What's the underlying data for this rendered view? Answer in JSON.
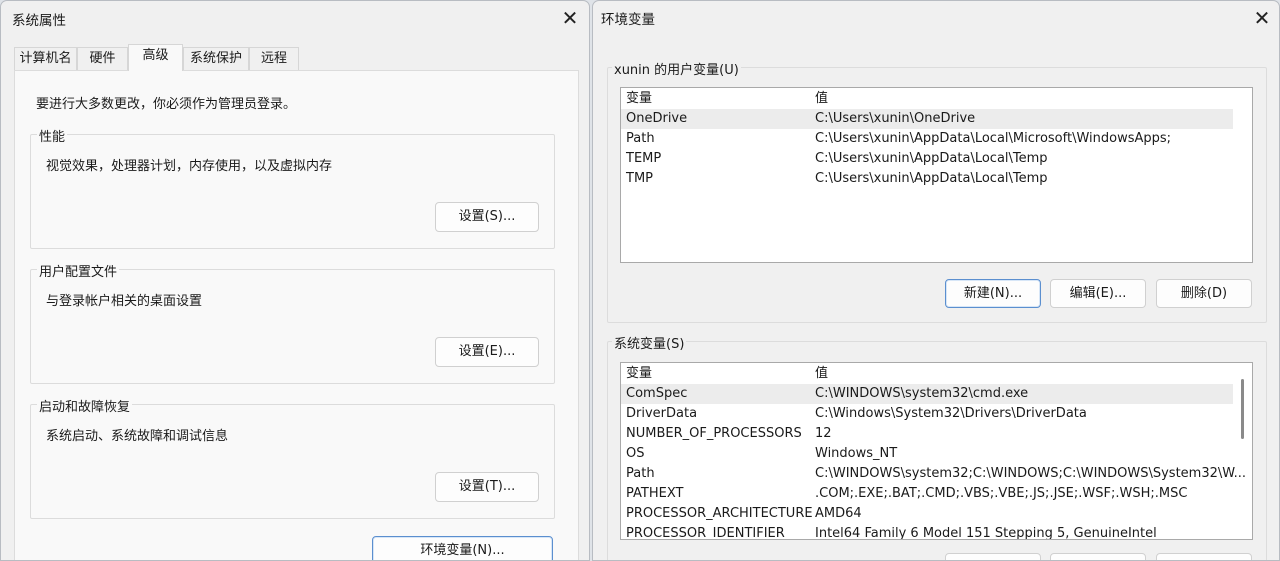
{
  "sys_props": {
    "title": "系统属性",
    "tabs": [
      "计算机名",
      "硬件",
      "高级",
      "系统保护",
      "远程"
    ],
    "admin_note": "要进行大多数更改，你必须作为管理员登录。",
    "groups": [
      {
        "label": "性能",
        "desc": "视觉效果，处理器计划，内存使用，以及虚拟内存",
        "button": "设置(S)..."
      },
      {
        "label": "用户配置文件",
        "desc": "与登录帐户相关的桌面设置",
        "button": "设置(E)..."
      },
      {
        "label": "启动和故障恢复",
        "desc": "系统启动、系统故障和调试信息",
        "button": "设置(T)..."
      }
    ],
    "env_button": "环境变量(N)..."
  },
  "env_vars": {
    "title": "环境变量",
    "user_group": "xunin 的用户变量(U)",
    "system_group": "系统变量(S)",
    "col_var": "变量",
    "col_val": "值",
    "user_rows": [
      [
        "OneDrive",
        "C:\\Users\\xunin\\OneDrive"
      ],
      [
        "Path",
        "C:\\Users\\xunin\\AppData\\Local\\Microsoft\\WindowsApps;"
      ],
      [
        "TEMP",
        "C:\\Users\\xunin\\AppData\\Local\\Temp"
      ],
      [
        "TMP",
        "C:\\Users\\xunin\\AppData\\Local\\Temp"
      ]
    ],
    "system_rows": [
      [
        "ComSpec",
        "C:\\WINDOWS\\system32\\cmd.exe"
      ],
      [
        "DriverData",
        "C:\\Windows\\System32\\Drivers\\DriverData"
      ],
      [
        "NUMBER_OF_PROCESSORS",
        "12"
      ],
      [
        "OS",
        "Windows_NT"
      ],
      [
        "Path",
        "C:\\WINDOWS\\system32;C:\\WINDOWS;C:\\WINDOWS\\System32\\W..."
      ],
      [
        "PATHEXT",
        ".COM;.EXE;.BAT;.CMD;.VBS;.VBE;.JS;.JSE;.WSF;.WSH;.MSC"
      ],
      [
        "PROCESSOR_ARCHITECTURE",
        "AMD64"
      ],
      [
        "PROCESSOR_IDENTIFIER",
        "Intel64 Family 6 Model 151 Stepping 5, GenuineIntel"
      ]
    ],
    "user_buttons": [
      "新建(N)...",
      "编辑(E)...",
      "删除(D)"
    ]
  }
}
